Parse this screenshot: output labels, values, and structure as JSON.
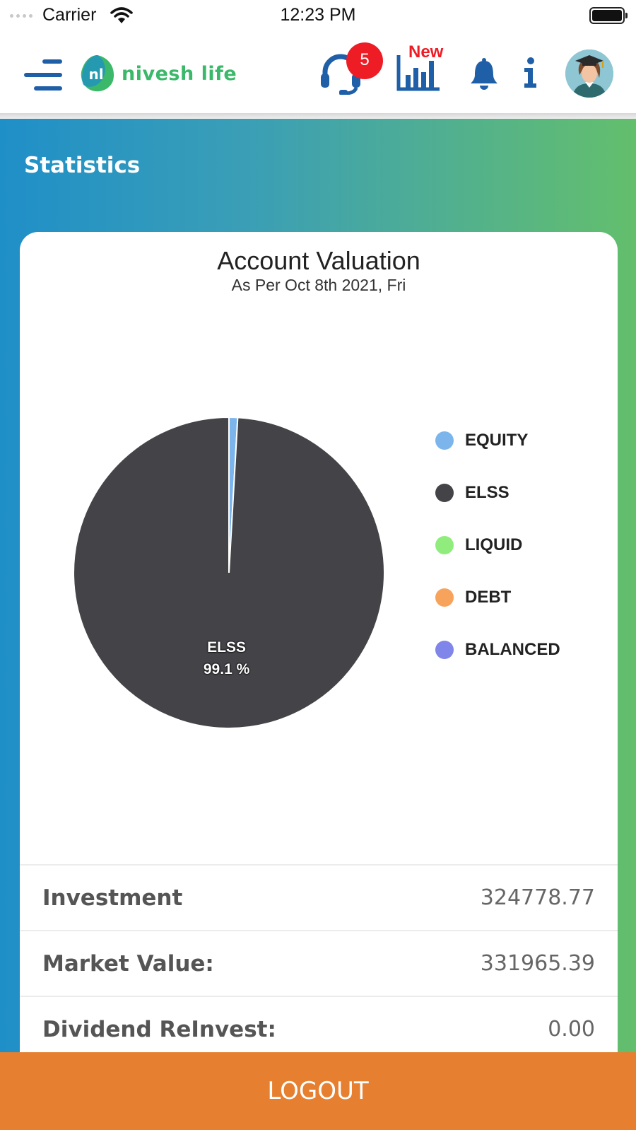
{
  "status_bar": {
    "carrier": "Carrier",
    "time": "12:23 PM"
  },
  "header": {
    "logo_text": "nivesh life",
    "logo_mark_text": "nl",
    "support_badge_count": "5",
    "new_tag": "New",
    "icons": [
      "menu-icon",
      "headset-icon",
      "bar-chart-icon",
      "bell-icon",
      "info-icon",
      "avatar"
    ]
  },
  "page": {
    "title": "Statistics"
  },
  "card": {
    "title": "Account Valuation",
    "subtitle": "As Per Oct 8th 2021, Fri"
  },
  "chart_data": {
    "type": "pie",
    "title": "Account Valuation",
    "subtitle": "As Per Oct 8th 2021, Fri",
    "categories": [
      "EQUITY",
      "ELSS",
      "LIQUID",
      "DEBT",
      "BALANCED"
    ],
    "values": [
      0.9,
      99.1,
      0,
      0,
      0
    ],
    "colors": [
      "#7cb5ec",
      "#434348",
      "#90ed7d",
      "#f7a35c",
      "#8085e9"
    ],
    "data_labels": [
      {
        "category": "ELSS",
        "text": "99.1 %"
      }
    ],
    "legend_position": "right"
  },
  "stats": [
    {
      "label": "Investment",
      "value": "324778.77"
    },
    {
      "label": "Market Value:",
      "value": "331965.39"
    },
    {
      "label": "Dividend ReInvest:",
      "value": "0.00"
    }
  ],
  "footer": {
    "logout_label": "LOGOUT"
  },
  "colors": {
    "brand_blue": "#1f5fa8",
    "brand_green": "#3bb86a",
    "gradient_start": "#1f8fc8",
    "gradient_end": "#63bf6c",
    "badge_red": "#ee1c25",
    "logout_orange": "#e67f2f"
  }
}
